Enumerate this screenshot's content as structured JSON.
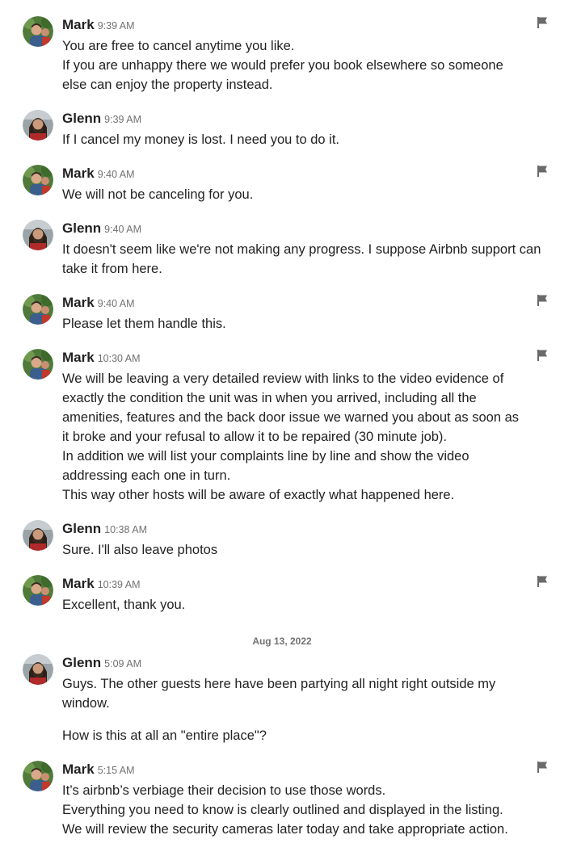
{
  "date_separator": "Aug 13, 2022",
  "messages": [
    {
      "author": "Mark",
      "time": "9:39 AM",
      "lines": [
        "You are free to cancel anytime you like.",
        "If you are unhappy there we would prefer you book elsewhere so someone",
        "else can enjoy the property instead."
      ]
    },
    {
      "author": "Glenn",
      "time": "9:39 AM",
      "lines": [
        "If I cancel my money is lost. I need you to do it."
      ]
    },
    {
      "author": "Mark",
      "time": "9:40 AM",
      "lines": [
        "We will not be canceling for you."
      ]
    },
    {
      "author": "Glenn",
      "time": "9:40 AM",
      "lines": [
        "It doesn't seem like we're not making any progress. I suppose Airbnb support can",
        "take it from here."
      ]
    },
    {
      "author": "Mark",
      "time": "9:40 AM",
      "lines": [
        "Please let them handle this."
      ]
    },
    {
      "author": "Mark",
      "time": "10:30 AM",
      "lines": [
        "We will be leaving a very detailed review with links to the video evidence of",
        "exactly the condition the unit was in when you arrived, including all the",
        "amenities, features and the back door issue we warned you about as soon as",
        "it broke and your refusal to allow it to be repaired (30 minute job).",
        "In addition we will list your complaints line by line and show the video",
        "addressing each one in turn.",
        "This way other hosts will be aware of exactly what happened here."
      ]
    },
    {
      "author": "Glenn",
      "time": "10:38 AM",
      "lines": [
        "Sure. I'll also leave photos"
      ]
    },
    {
      "author": "Mark",
      "time": "10:39 AM",
      "lines": [
        "Excellent, thank you."
      ]
    },
    {
      "author": "Glenn",
      "time": "5:09 AM",
      "lines": [
        "Guys. The other guests here have been partying all night right outside my",
        "window.",
        "How is this at all an \"entire place\"?"
      ]
    },
    {
      "author": "Mark",
      "time": "5:15 AM",
      "lines": [
        "It’s airbnb’s verbiage their decision to use those words.",
        "Everything you need to know is clearly outlined and displayed in the listing.",
        "We will review the security cameras later today and take appropriate action."
      ]
    }
  ],
  "icons": {
    "report": "flag-icon"
  }
}
